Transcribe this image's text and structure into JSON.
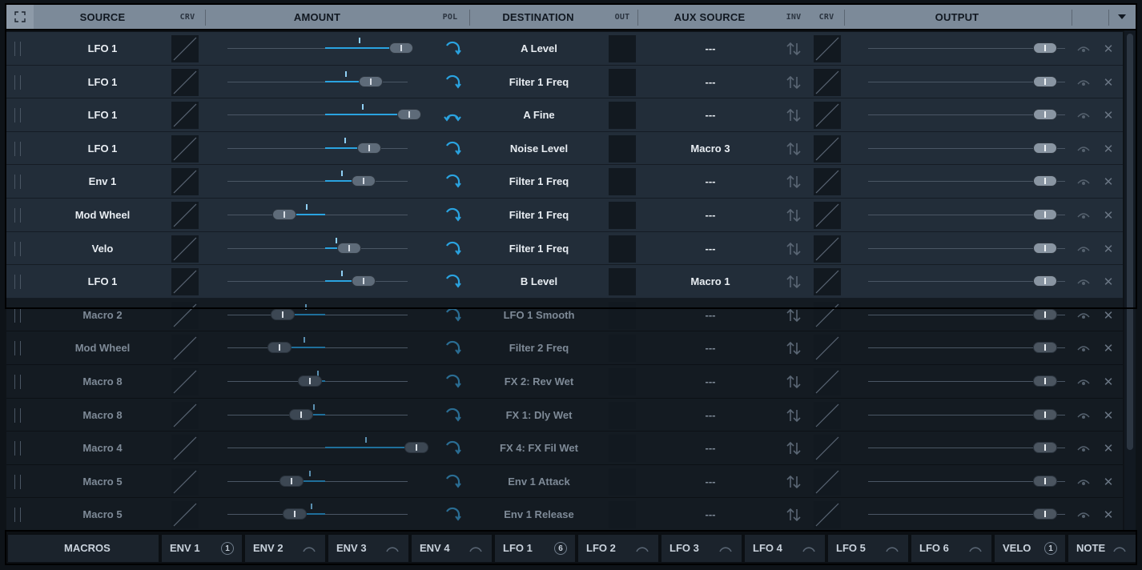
{
  "header": {
    "source": "SOURCE",
    "crv": "CRV",
    "amount": "AMOUNT",
    "pol": "POL",
    "destination": "DESTINATION",
    "out": "OUT",
    "aux_source": "AUX SOURCE",
    "inv": "INV",
    "crv2": "CRV",
    "output": "OUTPUT"
  },
  "rows": [
    {
      "source": "LFO 1",
      "amount": 0.5,
      "destination": "A Level",
      "aux": "---",
      "pol": "uni",
      "active": true
    },
    {
      "source": "LFO 1",
      "amount": 0.3,
      "destination": "Filter 1 Freq",
      "aux": "---",
      "pol": "uni",
      "active": true
    },
    {
      "source": "LFO 1",
      "amount": 0.55,
      "destination": "A Fine",
      "aux": "---",
      "pol": "bi",
      "active": true
    },
    {
      "source": "LFO 1",
      "amount": 0.29,
      "destination": "Noise Level",
      "aux": "Macro 3",
      "pol": "uni",
      "active": true
    },
    {
      "source": "Env 1",
      "amount": 0.25,
      "destination": "Filter 1 Freq",
      "aux": "---",
      "pol": "uni",
      "active": true
    },
    {
      "source": "Mod Wheel",
      "amount": -0.27,
      "destination": "Filter 1 Freq",
      "aux": "---",
      "pol": "uni",
      "active": true
    },
    {
      "source": "Velo",
      "amount": 0.16,
      "destination": "Filter 1 Freq",
      "aux": "---",
      "pol": "uni",
      "active": true
    },
    {
      "source": "LFO 1",
      "amount": 0.25,
      "destination": "B Level",
      "aux": "Macro 1",
      "pol": "uni",
      "active": true
    },
    {
      "source": "Macro 2",
      "amount": -0.28,
      "destination": "LFO 1 Smooth",
      "aux": "---",
      "pol": "uni",
      "active": false
    },
    {
      "source": "Mod Wheel",
      "amount": -0.3,
      "destination": "Filter 2 Freq",
      "aux": "---",
      "pol": "uni",
      "active": false
    },
    {
      "source": "Macro 8",
      "amount": -0.1,
      "destination": "FX 2: Rev Wet",
      "aux": "---",
      "pol": "uni",
      "active": false
    },
    {
      "source": "Macro 8",
      "amount": -0.16,
      "destination": "FX 1: Dly Wet",
      "aux": "---",
      "pol": "uni",
      "active": false
    },
    {
      "source": "Macro 4",
      "amount": 0.6,
      "destination": "FX 4: FX Fil Wet",
      "aux": "---",
      "pol": "uni",
      "active": false
    },
    {
      "source": "Macro 5",
      "amount": -0.22,
      "destination": "Env 1 Attack",
      "aux": "---",
      "pol": "uni",
      "active": false
    },
    {
      "source": "Macro 5",
      "amount": -0.2,
      "destination": "Env 1 Release",
      "aux": "---",
      "pol": "uni",
      "active": false
    }
  ],
  "bottom_tabs": [
    {
      "label": "MACROS",
      "badge": ""
    },
    {
      "label": "ENV 1",
      "badge": "1"
    },
    {
      "label": "ENV 2",
      "badge": ""
    },
    {
      "label": "ENV 3",
      "badge": ""
    },
    {
      "label": "ENV 4",
      "badge": ""
    },
    {
      "label": "LFO 1",
      "badge": "6"
    },
    {
      "label": "LFO 2",
      "badge": ""
    },
    {
      "label": "LFO 3",
      "badge": ""
    },
    {
      "label": "LFO 4",
      "badge": ""
    },
    {
      "label": "LFO 5",
      "badge": ""
    },
    {
      "label": "LFO 6",
      "badge": ""
    },
    {
      "label": "VELO",
      "badge": "1"
    },
    {
      "label": "NOTE",
      "badge": ""
    }
  ],
  "colors": {
    "accent": "#2aa3e0",
    "header_bg": "#7c8a99",
    "row_bg": "#222d39"
  }
}
